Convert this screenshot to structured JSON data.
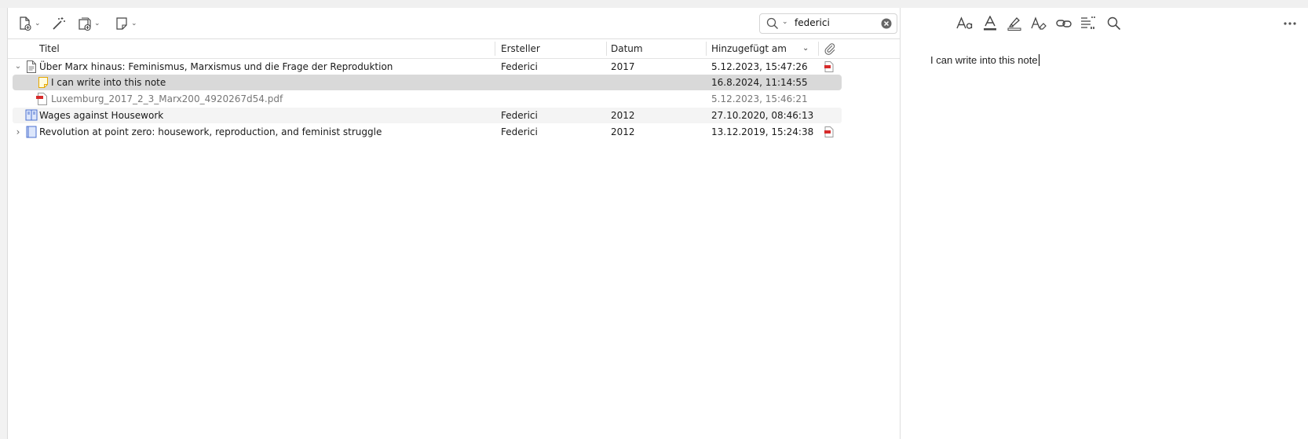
{
  "search": {
    "value": "federici",
    "placeholder": ""
  },
  "columns": {
    "title": "Titel",
    "creator": "Ersteller",
    "date": "Datum",
    "added": "Hinzugefügt am"
  },
  "rows": [
    {
      "title": "Über Marx hinaus: Feminismus, Marxismus und die Frage der Reproduktion",
      "creator": "Federici",
      "date": "2017",
      "added": "5.12.2023, 15:47:26",
      "icon": "document-icon",
      "expanded": true
    },
    {
      "title": "I can write into this note",
      "creator": "",
      "date": "",
      "added": "16.8.2024, 11:14:55",
      "icon": "note-icon",
      "selected": true
    },
    {
      "title": "Luxemburg_2017_2_3_Marx200_4920267d54.pdf",
      "creator": "",
      "date": "",
      "added": "5.12.2023, 15:46:21",
      "icon": "pdf-icon"
    },
    {
      "title": "Wages against Housework",
      "creator": "Federici",
      "date": "2012",
      "added": "27.10.2020, 08:46:13",
      "icon": "book-section-icon"
    },
    {
      "title": "Revolution at point zero: housework, reproduction, and feminist struggle",
      "creator": "Federici",
      "date": "2012",
      "added": "13.12.2019, 15:24:38",
      "icon": "book-icon",
      "expanded": false
    }
  ],
  "note": {
    "text": "I can write into this note"
  },
  "colors": {
    "selection": "#d9d9d9",
    "pdf": "#d62b2b",
    "note": "#f0b400",
    "book": "#4a6fcf"
  }
}
